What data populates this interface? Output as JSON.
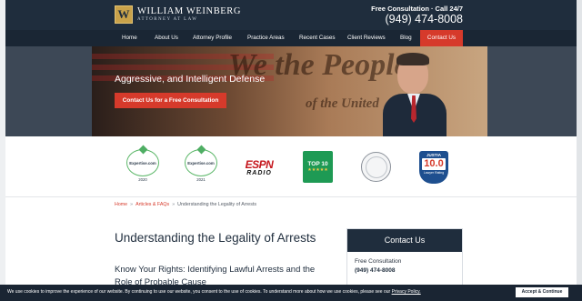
{
  "header": {
    "logo_mark": "W",
    "logo_name": "WILLIAM WEINBERG",
    "logo_sub": "ATTORNEY AT LAW",
    "consult_label": "Free Consultation · Call 24/7",
    "consult_phone": "(949) 474-8008"
  },
  "nav": {
    "items": [
      "Home",
      "About Us",
      "Attorney Profile",
      "Practice Areas",
      "Recent Cases",
      "Client Reviews",
      "Blog",
      "Contact Us"
    ],
    "active": "Contact Us"
  },
  "hero": {
    "script_1": "We the People",
    "script_2": "of the United",
    "title": "Aggressive, and Intelligent Defense",
    "button": "Contact Us for a Free Consultation"
  },
  "badges": [
    {
      "name": "expertise-2020",
      "brand": "Expertise.com",
      "year": "2020"
    },
    {
      "name": "expertise-2021",
      "brand": "Expertise.com",
      "year": "2021"
    },
    {
      "name": "espn-radio",
      "line1": "ESPN",
      "line2": "RADIO"
    },
    {
      "name": "top-10",
      "line1": "TOP 10",
      "stars": "★★★★★"
    },
    {
      "name": "seal",
      "text": "Seal"
    },
    {
      "name": "justia",
      "line1": "JUSTIA",
      "rating": "10.0",
      "line3": "Lawyer Rating"
    }
  ],
  "breadcrumb": {
    "home": "Home",
    "articles": "Articles & FAQs",
    "current": "Understanding the Legality of Arrests"
  },
  "content": {
    "title": "Understanding the Legality of Arrests",
    "subhead": "Know Your Rights: Identifying Lawful Arrests and the Role of Probable Cause"
  },
  "contact_box": {
    "title": "Contact Us",
    "free_label": "Free Consultation",
    "phone": "(949) 474-8008"
  },
  "cookie": {
    "text": "We use cookies to improve the experience of our website. By continuing to use our website, you consent to the use of cookies. To understand more about how we use cookies, please see our",
    "link": "Privacy Policy.",
    "button": "Accept & Continue"
  },
  "colors": {
    "navy": "#1f2d3d",
    "accent_red": "#d63a2b",
    "expertise_green": "#4fae64",
    "justia_blue": "#1e4f8f"
  }
}
